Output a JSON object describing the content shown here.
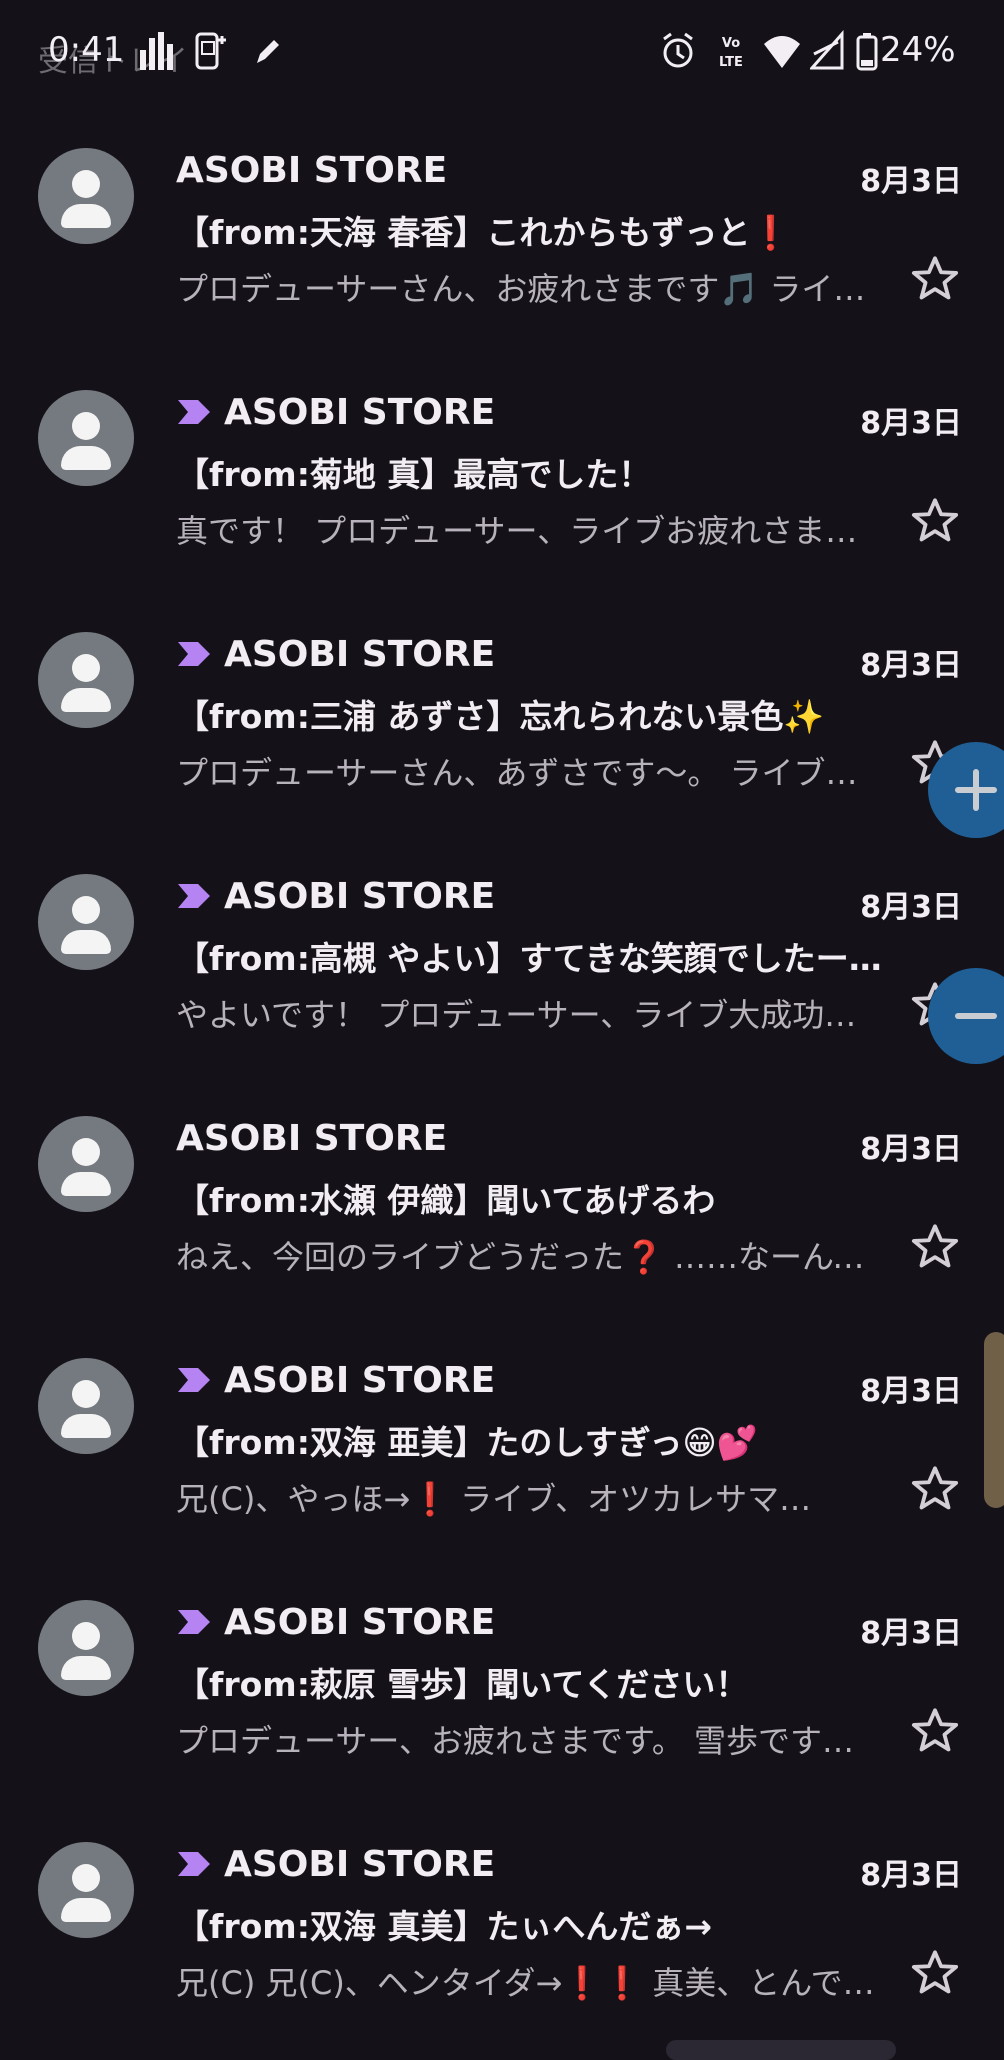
{
  "status_bar": {
    "time": "0:41",
    "behind_text": "受信トレイ",
    "battery": "24%"
  },
  "mail": {
    "items": [
      {
        "sender": "ASOBI STORE",
        "date": "8月3日",
        "subject": "【from:天海 春香】これからもずっと❗",
        "preview": "プロデューサーさん、お疲れさまです🎵 ライブ…",
        "important": false
      },
      {
        "sender": "ASOBI STORE",
        "date": "8月3日",
        "subject": "【from:菊地 真】最高でした！",
        "preview": "真です！ プロデューサー、ライブお疲れさまでした…",
        "important": true
      },
      {
        "sender": "ASOBI STORE",
        "date": "8月3日",
        "subject": "【from:三浦 あずさ】忘れられない景色✨",
        "preview": "プロデューサーさん、あずさです〜。 ライブ…",
        "important": true
      },
      {
        "sender": "ASOBI STORE",
        "date": "8月3日",
        "subject": "【from:高槻 やよい】すてきな笑顔でしたー…",
        "preview": "やよいです！ プロデューサー、ライブ大成功…",
        "important": true
      },
      {
        "sender": "ASOBI STORE",
        "date": "8月3日",
        "subject": "【from:水瀬 伊織】聞いてあげるわ",
        "preview": "ねえ、今回のライブどうだった❓ ……なーんて…",
        "important": false
      },
      {
        "sender": "ASOBI STORE",
        "date": "8月3日",
        "subject": "【from:双海 亜美】たのしすぎっ😁💕",
        "preview": "兄(C)、やっほ→❗ ライブ、オツカレサマ…",
        "important": true
      },
      {
        "sender": "ASOBI STORE",
        "date": "8月3日",
        "subject": "【from:萩原 雪歩】聞いてください！",
        "preview": "プロデューサー、お疲れさまです。 雪歩です…",
        "important": true
      },
      {
        "sender": "ASOBI STORE",
        "date": "8月3日",
        "subject": "【from:双海 真美】たぃへんだぁ→",
        "preview": "兄(C) 兄(C)、ヘンタイダ→❗❗ 真美、とんでも…",
        "important": true
      }
    ]
  },
  "icons": {
    "importance": "importance-marker-icon",
    "star": "star-outline-icon",
    "avatar": "person-avatar-icon",
    "zoom_in": "plus-icon",
    "zoom_out": "minus-icon"
  },
  "colors": {
    "background": "#141218",
    "importance_marker": "#b583f2",
    "fab": "#1f5f96",
    "text_primary": "#f1edf3",
    "text_secondary": "#b7b2bb"
  }
}
